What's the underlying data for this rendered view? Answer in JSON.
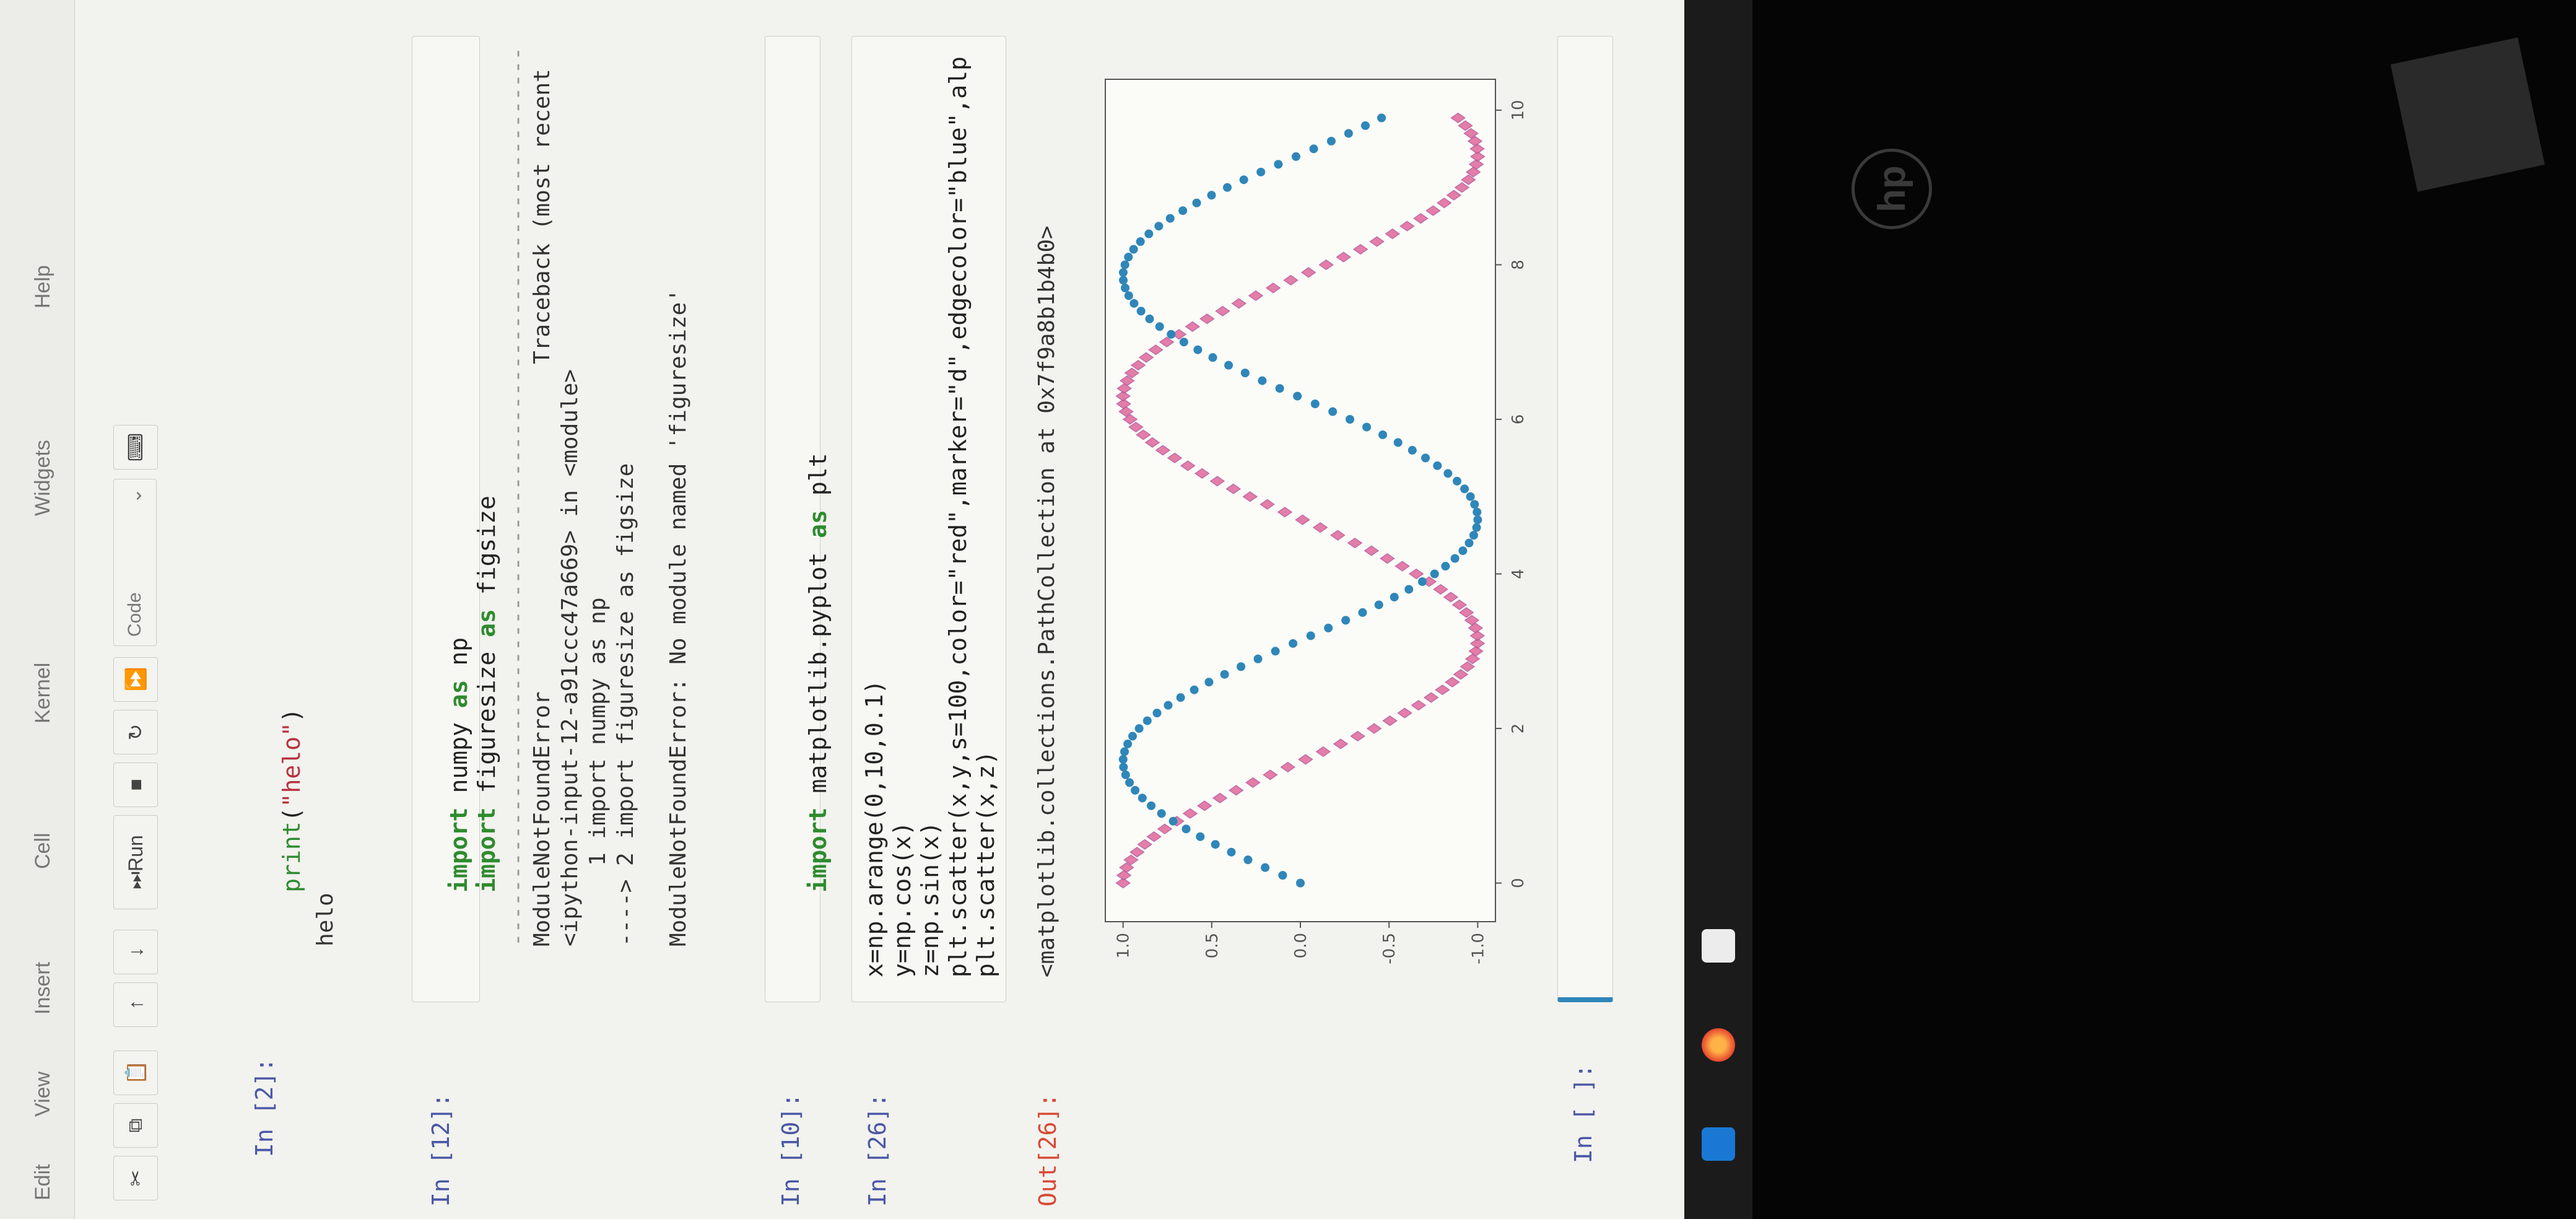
{
  "menu": {
    "items": [
      "Edit",
      "View",
      "Insert",
      "Cell",
      "Kernel",
      "Widgets",
      "Help"
    ]
  },
  "toolbar": {
    "run_label": "Run",
    "cell_type": "Code",
    "cut_icon": "scissors-icon",
    "copy_icon": "copy-icon",
    "paste_icon": "paste-icon",
    "up_icon": "arrow-up-icon",
    "down_icon": "arrow-down-icon",
    "stop_icon": "stop-icon",
    "restart_icon": "restart-icon",
    "fastforward_icon": "fast-forward-icon",
    "keyboard_icon": "keyboard-icon"
  },
  "cells": {
    "c1": {
      "prompt": "In [2]:",
      "code": "print(\"helo\")",
      "output": "helo"
    },
    "c2": {
      "prompt": "In [12]:",
      "line1": "import numpy as np",
      "line2": "import figuresize as figsize",
      "err_header": "ModuleNotFoundError",
      "traceback": "Traceback (most recent",
      "err_loc": "<ipython-input-12-a91ccc47a669> in <module>",
      "err_l1": "      1 import numpy as np",
      "err_l2": "----> 2 import figuresize as figsize",
      "err_msg": "ModuleNotFoundError: No module named 'figuresize'"
    },
    "c3": {
      "prompt": "In [10]:",
      "code": "import matplotlib.pyplot as plt"
    },
    "c4": {
      "prompt": "In [26]:",
      "l1": "x=np.arange(0,10,0.1)",
      "l2": "y=np.cos(x)",
      "l3": "z=np.sin(x)",
      "l4": "plt.scatter(x,y,s=100,color=\"red\",marker=\"d\",edgecolor=\"blue\",alp",
      "l5": "plt.scatter(x,z)",
      "out_prompt": "Out[26]:",
      "out_text": "<matplotlib.collections.PathCollection at 0x7f9a8b1b4b0>"
    },
    "c5": {
      "prompt": "In [ ]:"
    }
  },
  "colors": {
    "blue_points": "#2f86b9",
    "pink_points": "#e0689a",
    "pink_edge": "#b4559a"
  },
  "chart_data": {
    "type": "scatter",
    "title": "",
    "xlabel": "",
    "ylabel": "",
    "xlim": [
      -0.5,
      10.4
    ],
    "ylim": [
      -1.1,
      1.1
    ],
    "xticks": [
      "0",
      "2",
      "4",
      "6",
      "8",
      "10"
    ],
    "yticks": [
      "1.0",
      "0.5",
      "0.0",
      "-0.5",
      "-1.0"
    ],
    "grid": false,
    "series": [
      {
        "function": "cos(x)",
        "x_start": 0,
        "x_stop": 10,
        "x_step": 0.1,
        "color": "#e0689a",
        "marker": "d"
      },
      {
        "function": "sin(x)",
        "x_start": 0,
        "x_stop": 10,
        "x_step": 0.1,
        "color": "#2f86b9",
        "marker": "o"
      }
    ]
  },
  "taskbar": {
    "icons": [
      "pen-icon",
      "firefox-icon",
      "files-icon"
    ]
  },
  "brand": {
    "logo": "hp"
  }
}
